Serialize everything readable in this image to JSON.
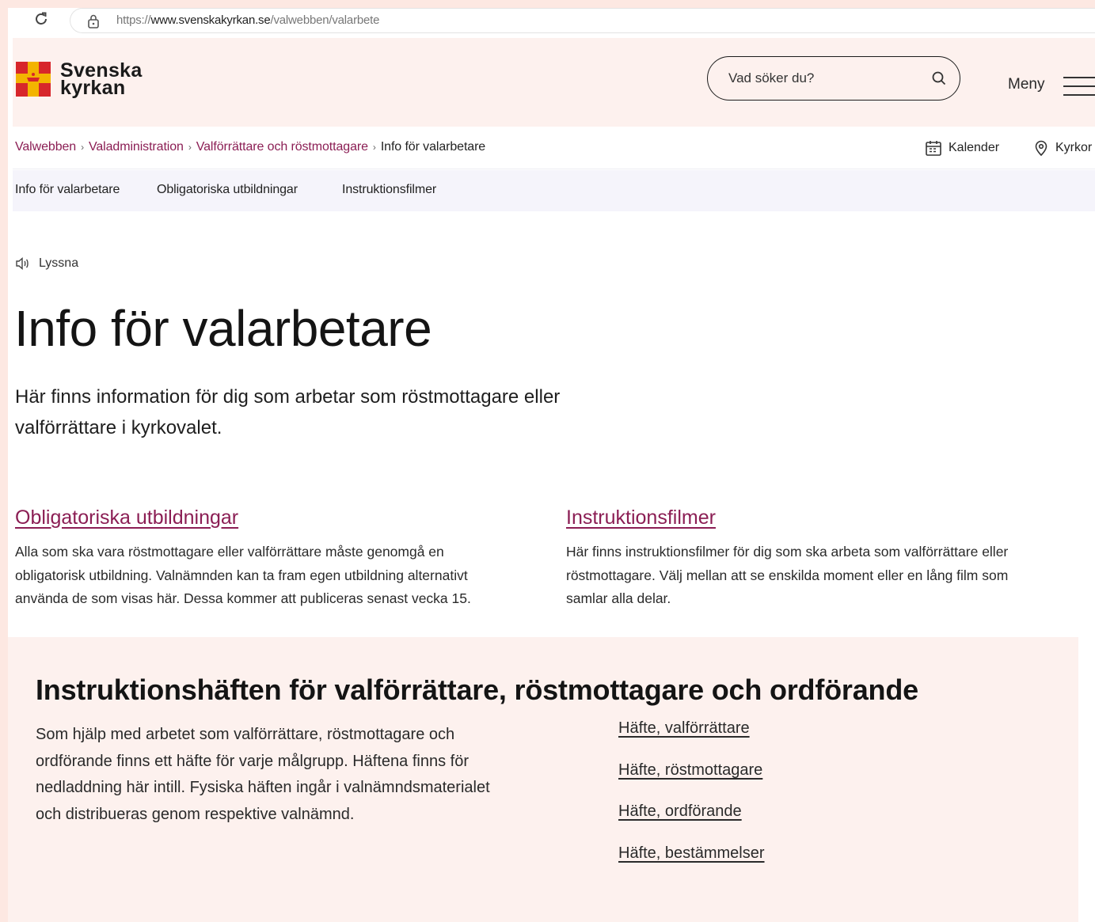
{
  "browser": {
    "url_prefix": "https://",
    "url_domain": "www.svenskakyrkan.se",
    "url_path": "/valwebben/valarbete"
  },
  "header": {
    "logo_line1": "Svenska",
    "logo_line2": "kyrkan",
    "search_placeholder": "Vad söker du?",
    "menu_label": "Meny"
  },
  "breadcrumb": {
    "items": [
      "Valwebben",
      "Valadministration",
      "Valförrättare och röstmottagare"
    ],
    "current": "Info för valarbetare",
    "separator": "›"
  },
  "utility": {
    "calendar_label": "Kalender",
    "location_label": "Kyrkor"
  },
  "subnav": {
    "items": [
      "Info för valarbetare",
      "Obligatoriska utbildningar",
      "Instruktionsfilmer"
    ]
  },
  "main": {
    "listen_label": "Lyssna",
    "title": "Info för valarbetare",
    "intro_line1": "Här finns information för dig som arbetar som röstmottagare eller",
    "intro_line2": "valförrättare i kyrkovalet.",
    "cards": [
      {
        "title": "Obligatoriska utbildningar",
        "lines": [
          "Alla som ska vara röstmottagare eller valförrättare måste genomgå en",
          "obligatorisk utbildning. Valnämnden kan ta fram egen utbildning alternativt",
          "använda de som visas här. Dessa kommer att publiceras senast vecka 15."
        ]
      },
      {
        "title": "Instruktionsfilmer",
        "lines": [
          "Här finns instruktionsfilmer för dig som ska arbeta som valförrättare eller",
          "röstmottagare. Välj mellan att se enskilda moment eller en lång film som",
          "samlar alla delar."
        ]
      }
    ]
  },
  "booklets": {
    "heading": "Instruktionshäften för valförrättare, röstmottagare och ordförande",
    "body_lines": [
      "Som hjälp med arbetet som valförrättare, röstmottagare och",
      "ordförande finns ett häfte för varje målgrupp. Häftena finns för",
      "nedladdning här intill. Fysiska häften ingår i valnämndsmaterialet",
      "och distribueras genom respektive valnämnd."
    ],
    "links": [
      "Häfte, valförrättare",
      "Häfte, röstmottagare",
      "Häfte, ordförande",
      "Häfte, bestämmelser"
    ]
  },
  "colors": {
    "accent": "#8b1e54",
    "header_bg": "#fdf1ee",
    "subnav_bg": "#f5f4fb",
    "logo_red": "#d7262b",
    "logo_yellow": "#f3b400"
  },
  "icons": [
    "reload-icon",
    "lock-icon",
    "church-cross-logo-icon",
    "search-icon",
    "hamburger-icon",
    "calendar-icon",
    "location-pin-icon",
    "speaker-icon"
  ]
}
